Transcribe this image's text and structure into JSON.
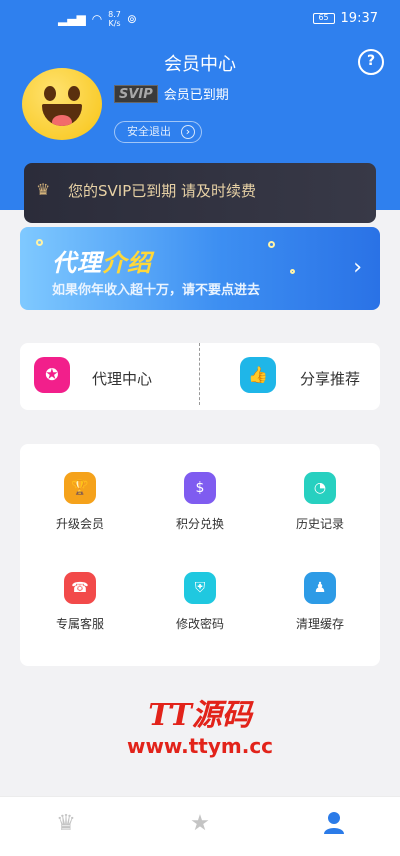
{
  "status_bar": {
    "network_label": "8.7\nK/s",
    "battery": "65",
    "time": "19:37"
  },
  "header": {
    "title": "会员中心",
    "help_icon": "question-circle-icon",
    "svip_badge": "SVIP",
    "svip_status": "会员已到期",
    "logout_label": "安全退出"
  },
  "expire_notice": {
    "icon": "crown-icon",
    "text": "您的SVIP已到期 请及时续费"
  },
  "agent_banner": {
    "title_part1": "代理",
    "title_part2": "介绍",
    "subtitle": "如果你年收入超十万，请不要点进去"
  },
  "entries": [
    {
      "label": "代理中心",
      "icon": "medal-ribbon-icon",
      "color": "#f21f8b"
    },
    {
      "label": "分享推荐",
      "icon": "thumbs-up-icon",
      "color": "#1fb6e8"
    }
  ],
  "grid": [
    {
      "label": "升级会员",
      "icon": "trophy-icon",
      "color": "#f5a21b"
    },
    {
      "label": "积分兑换",
      "icon": "money-bag-icon",
      "color": "#7f5cf0"
    },
    {
      "label": "历史记录",
      "icon": "footprints-icon",
      "color": "#27d0c0"
    },
    {
      "label": "专属客服",
      "icon": "customer-service-icon",
      "color": "#f24a4a"
    },
    {
      "label": "修改密码",
      "icon": "shield-lock-icon",
      "color": "#1fc8e0"
    },
    {
      "label": "清理缓存",
      "icon": "user-clean-icon",
      "color": "#2d9be6"
    }
  ],
  "watermark": {
    "logo": "TT源码",
    "url": "www.ttym.cc"
  },
  "bottom_nav": [
    {
      "icon": "crown-icon",
      "active": false
    },
    {
      "icon": "star-icon",
      "active": false
    },
    {
      "icon": "person-icon",
      "active": true
    }
  ],
  "colors": {
    "header_blue": "#2f80ee",
    "nav_active": "#2b7be8",
    "gold_text": "#e7d1a5"
  }
}
